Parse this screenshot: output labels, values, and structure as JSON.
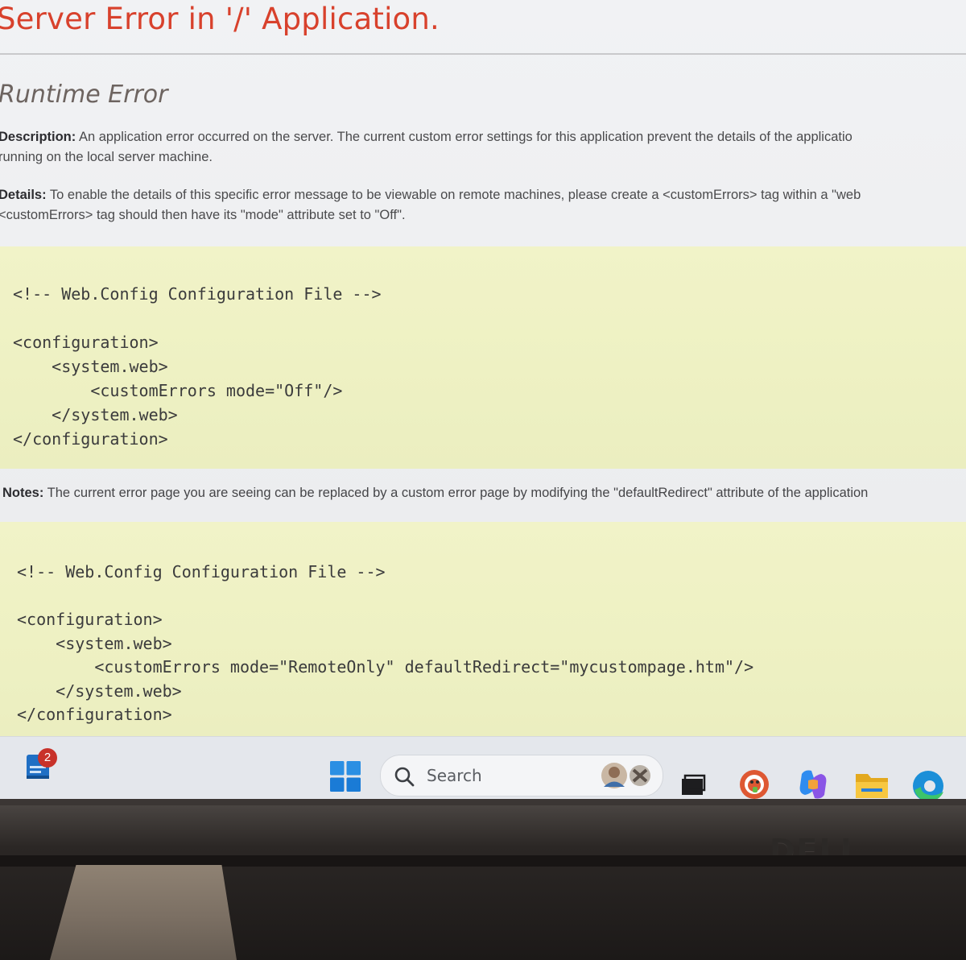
{
  "page": {
    "title": "Server Error in '/' Application.",
    "subtitle": "Runtime Error",
    "description": {
      "label": "Description:",
      "line1": " An application error occurred on the server. The current custom error settings for this application prevent the details of the applicatio",
      "line2": "running on the local server machine."
    },
    "details": {
      "label": "Details:",
      "line1": " To enable the details of this specific error message to be viewable on remote machines, please create a <customErrors> tag within a \"web",
      "line2": "<customErrors> tag should then have its \"mode\" attribute set to \"Off\"."
    },
    "code_block_1": "<!-- Web.Config Configuration File -->\n\n<configuration>\n    <system.web>\n        <customErrors mode=\"Off\"/>\n    </system.web>\n</configuration>",
    "notes": {
      "label": "Notes:",
      "text": " The current error page you are seeing can be replaced by a custom error page by modifying the \"defaultRedirect\" attribute of the application"
    },
    "code_block_2": "<!-- Web.Config Configuration File -->\n\n<configuration>\n    <system.web>\n        <customErrors mode=\"RemoteOnly\" defaultRedirect=\"mycustompage.htm\"/>\n    </system.web>\n</configuration>"
  },
  "taskbar": {
    "widgets_badge": "2",
    "search_label": "Search",
    "pinned": [
      "widgets-icon",
      "start-icon",
      "task-view-icon",
      "duckduckgo-icon",
      "copilot-icon",
      "file-explorer-icon",
      "edge-icon"
    ]
  },
  "colors": {
    "title": "#d8412c",
    "code_background": "#eef1c3",
    "badge": "#c8322a"
  },
  "bezel": {
    "brand": "DELL"
  }
}
